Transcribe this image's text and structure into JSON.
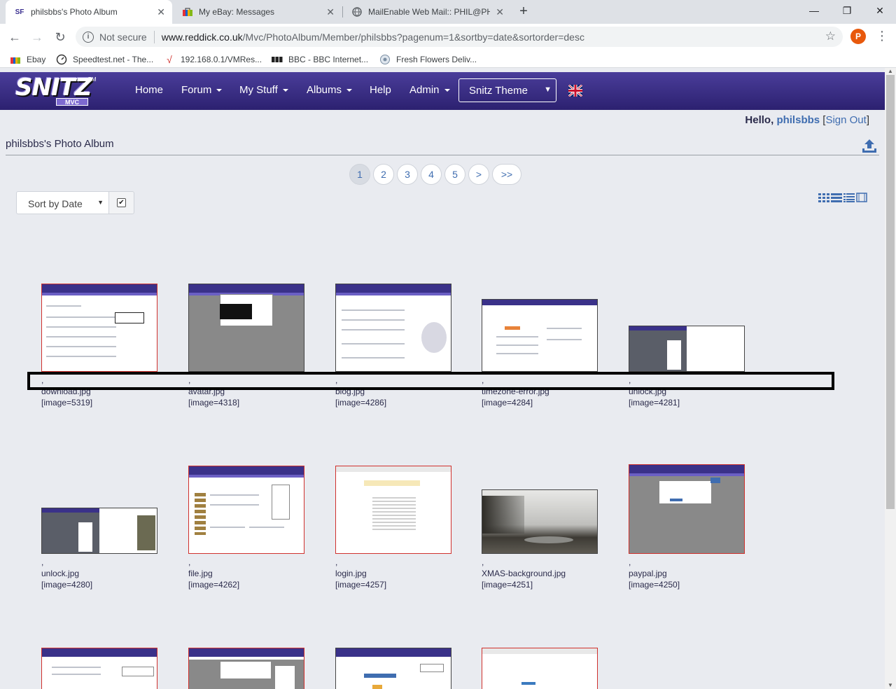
{
  "browser": {
    "tabs": [
      {
        "title": "philsbbs's Photo Album",
        "favicon": "SF",
        "active": true
      },
      {
        "title": "My eBay: Messages",
        "favicon": "bag"
      },
      {
        "title": "MailEnable Web Mail:: PHIL@PHI",
        "favicon": "globe"
      }
    ],
    "new_tab": "+",
    "window": {
      "minimize": "—",
      "restore": "❐",
      "close": "✕"
    },
    "address": {
      "not_secure": "Not secure",
      "host": "www.reddick.co.uk",
      "path": "/Mvc/PhotoAlbum/Member/philsbbs?pagenum=1&sortby=date&sortorder=desc"
    },
    "profile_initial": "P",
    "bookmarks": [
      {
        "label": "Ebay",
        "icon": "ebay-bag-icon"
      },
      {
        "label": "Speedtest.net - The...",
        "icon": "speedometer-icon"
      },
      {
        "label": "192.168.0.1/VMRes...",
        "icon": "tick-icon"
      },
      {
        "label": "BBC - BBC Internet...",
        "icon": "bbc-icon"
      },
      {
        "label": "Fresh Flowers Deliv...",
        "icon": "globe-icon"
      }
    ]
  },
  "site": {
    "logo": {
      "word": "SNITZ",
      "sub": "MVC",
      "tm": "TM"
    },
    "nav": [
      {
        "label": "Home",
        "dropdown": false
      },
      {
        "label": "Forum",
        "dropdown": true
      },
      {
        "label": "My Stuff",
        "dropdown": true
      },
      {
        "label": "Albums",
        "dropdown": true
      },
      {
        "label": "Help",
        "dropdown": false
      },
      {
        "label": "Admin",
        "dropdown": true
      }
    ],
    "theme": "Snitz Theme",
    "greeting": {
      "hello": "Hello,",
      "user": "philsbbs",
      "sign_out": "Sign Out"
    }
  },
  "album": {
    "title": "philsbbs's Photo Album",
    "pager": [
      "1",
      "2",
      "3",
      "4",
      "5",
      ">",
      ">>"
    ],
    "active_page": "1",
    "sort": {
      "label": "Sort by Date",
      "descending": true
    },
    "images": [
      {
        "name": "download.jpg",
        "tag": "[image=5319]",
        "prefix": ","
      },
      {
        "name": "avatar.jpg",
        "tag": "[image=4318]",
        "prefix": ","
      },
      {
        "name": "blog.jpg",
        "tag": "[image=4286]",
        "prefix": ","
      },
      {
        "name": "timezone-error.jpg",
        "tag": "[image=4284]",
        "prefix": ","
      },
      {
        "name": "unlock.jpg",
        "tag": "[image=4281]",
        "prefix": ","
      },
      {
        "name": "unlock.jpg",
        "tag": "[image=4280]",
        "prefix": ","
      },
      {
        "name": "file.jpg",
        "tag": "[image=4262]",
        "prefix": ","
      },
      {
        "name": "login.jpg",
        "tag": "[image=4257]",
        "prefix": ","
      },
      {
        "name": "XMAS-background.jpg",
        "tag": "[image=4251]",
        "prefix": ","
      },
      {
        "name": "paypal.jpg",
        "tag": "[image=4250]",
        "prefix": ","
      }
    ]
  }
}
